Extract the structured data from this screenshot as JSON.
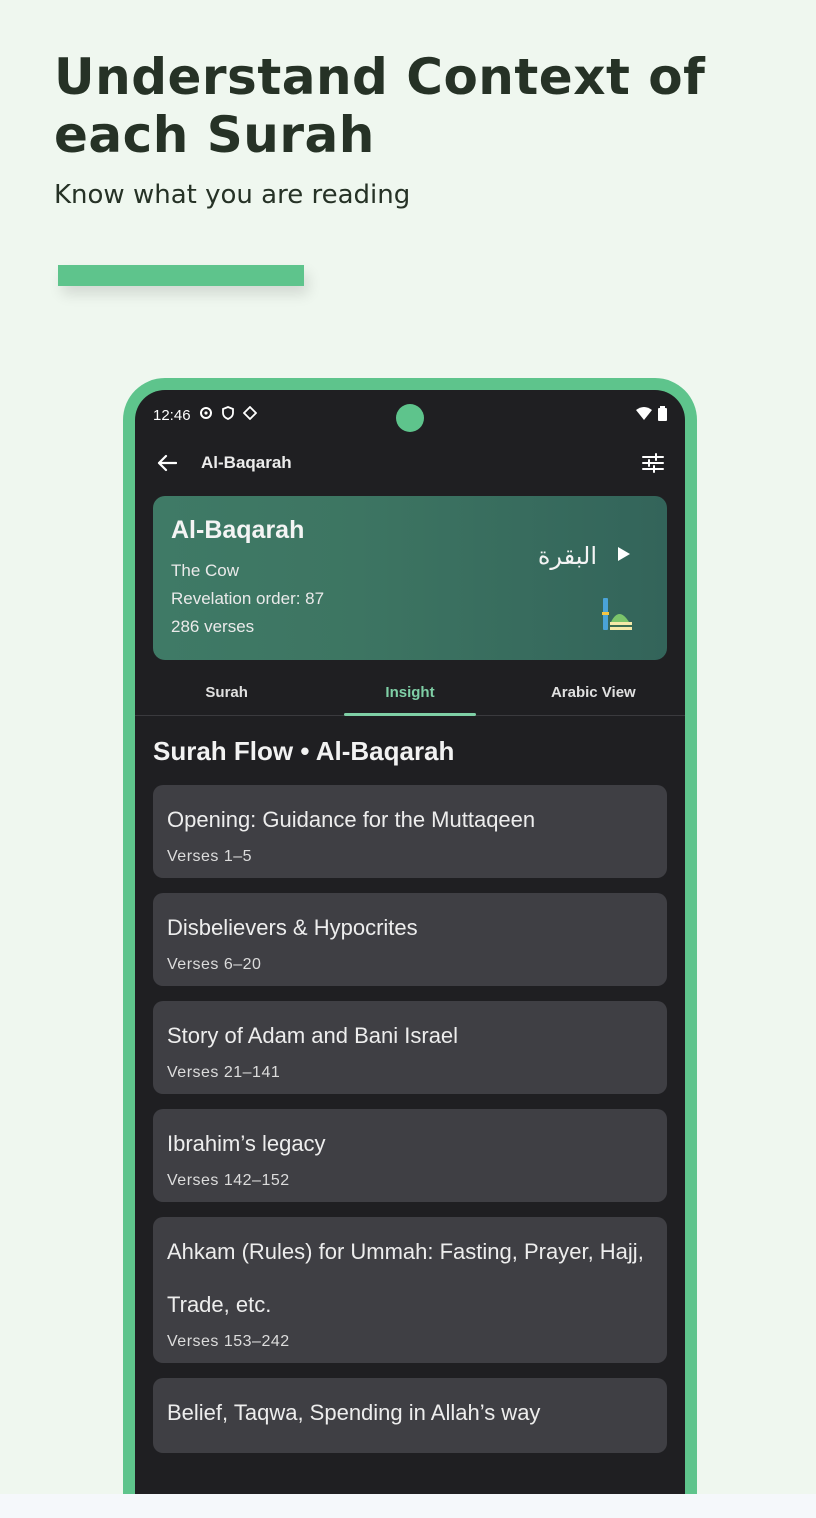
{
  "promo": {
    "headline": "Understand Context of each Surah",
    "subline": "Know what you are reading"
  },
  "status_bar": {
    "time": "12:46"
  },
  "app_bar": {
    "title": "Al-Baqarah",
    "back_icon": "arrow-left-icon",
    "settings_icon": "tune-icon"
  },
  "header_card": {
    "name": "Al-Baqarah",
    "translation": "The Cow",
    "revelation_order": "Revelation order: 87",
    "verses": "286 verses",
    "arabic_name": "البقرة",
    "play_icon": "play-icon",
    "place_icon": "madina-mosque-icon"
  },
  "tabs": [
    {
      "label": "Surah",
      "active": false
    },
    {
      "label": "Insight",
      "active": true
    },
    {
      "label": "Arabic View",
      "active": false
    }
  ],
  "section_title": "Surah Flow • Al-Baqarah",
  "flow_items": [
    {
      "title": "Opening: Guidance for the Muttaqeen",
      "verses": "Verses 1–5"
    },
    {
      "title": "Disbelievers & Hypocrites",
      "verses": "Verses 6–20"
    },
    {
      "title": "Story of Adam and Bani Israel",
      "verses": "Verses 21–141"
    },
    {
      "title": "Ibrahim’s legacy",
      "verses": "Verses 142–152"
    },
    {
      "title": "Ahkam (Rules) for Ummah: Fasting, Prayer, Hajj, Trade, etc.",
      "verses": "Verses 153–242"
    },
    {
      "title": "Belief, Taqwa, Spending in Allah’s way",
      "verses": ""
    }
  ],
  "colors": {
    "accent": "#5ec48c",
    "card_gradient": "#3f7a66",
    "tab_active": "#7fcfa6",
    "screen_bg": "#1f1f22",
    "item_bg": "#3f3f44"
  }
}
